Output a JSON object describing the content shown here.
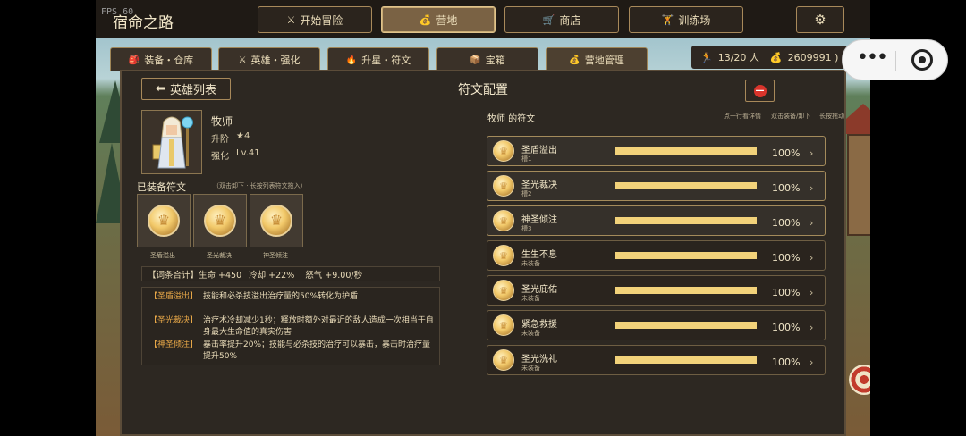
{
  "app": {
    "fps_label": "FPS 60",
    "title": "宿命之路"
  },
  "nav": {
    "items": [
      {
        "icon": "⚔",
        "label": "开始冒险"
      },
      {
        "icon": "💰",
        "label": "营地",
        "active": true
      },
      {
        "icon": "🛒",
        "label": "商店"
      },
      {
        "icon": "🏋",
        "label": "训练场"
      }
    ],
    "settings_icon": "⚙"
  },
  "subtabs": [
    {
      "icon": "🎒",
      "label": "装备・仓库"
    },
    {
      "icon": "⚔",
      "label": "英雄・强化"
    },
    {
      "icon": "🔥",
      "label": "升星・符文"
    },
    {
      "icon": "📦",
      "label": "宝箱"
    },
    {
      "icon": "💰",
      "label": "营地管理",
      "active": true
    }
  ],
  "stats": {
    "runner_icon": "🏃",
    "population": "13/20 人",
    "gold_icon": "💰",
    "gold": "2609991 )"
  },
  "panel": {
    "back_label": "英雄列表",
    "back_icon": "⬅",
    "title": "符文配置",
    "close_icon": "⛔"
  },
  "hero": {
    "name": "牧师",
    "star_label": "升阶",
    "star_value": "★4",
    "level_label": "强化",
    "level_value": "Lv.41"
  },
  "equipped": {
    "title": "已装备符文",
    "hint": "（双击卸下 · 长按列表符文拖入）",
    "slots": [
      "圣盾溢出",
      "圣光裁决",
      "神圣倾注"
    ]
  },
  "totals": {
    "label": "【词条合计】生命 +450",
    "cooldown": "冷却 +22%",
    "rage": "怒气 +9.00/秒"
  },
  "effects": [
    {
      "tag": "【圣盾溢出】",
      "desc": "技能和必杀技溢出治疗量的50%转化为护盾"
    },
    {
      "tag": "【圣光裁决】",
      "desc": "治疗术冷却减少1秒；释放时额外对最近的敌人造成一次相当于自身最大生命值的真实伤害"
    },
    {
      "tag": "【神圣倾注】",
      "desc": "暴击率提升20%；技能与必杀技的治疗可以暴击，暴击时治疗量提升50%"
    }
  ],
  "rune_list": {
    "title": "牧师 的符文",
    "hints": [
      "点一行看详情",
      "双击装备/卸下",
      "长按拖动"
    ],
    "items": [
      {
        "name": "圣盾溢出",
        "sub": "槽1",
        "progress": 1.0,
        "pct": "100%",
        "equipped": true
      },
      {
        "name": "圣光裁决",
        "sub": "槽2",
        "progress": 1.0,
        "pct": "100%",
        "equipped": true
      },
      {
        "name": "神圣倾注",
        "sub": "槽3",
        "progress": 1.0,
        "pct": "100%",
        "equipped": true
      },
      {
        "name": "生生不息",
        "sub": "未装备",
        "progress": 1.0,
        "pct": "100%",
        "equipped": false
      },
      {
        "name": "圣光庇佑",
        "sub": "未装备",
        "progress": 1.0,
        "pct": "100%",
        "equipped": false
      },
      {
        "name": "紧急救援",
        "sub": "未装备",
        "progress": 1.0,
        "pct": "100%",
        "equipped": false
      },
      {
        "name": "圣光洗礼",
        "sub": "未装备",
        "progress": 1.0,
        "pct": "100%",
        "equipped": false
      }
    ],
    "chevron": "›"
  },
  "miniprogram": {
    "more_icon": "•••"
  }
}
